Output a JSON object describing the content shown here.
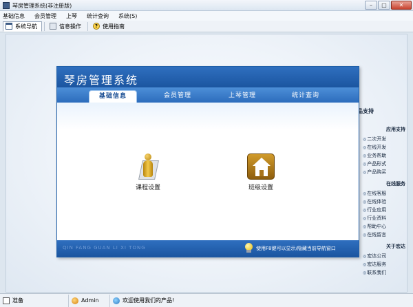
{
  "window": {
    "title": "琴房管理系统(非注册版)",
    "controls": {
      "minimize": "–",
      "maximize": "□",
      "close": "✕"
    }
  },
  "menu": [
    "基础信息",
    "会员管理",
    "上琴",
    "统计查询",
    "系统(S)"
  ],
  "toolbar": {
    "items": [
      {
        "label": "系统导航",
        "icon": "nav-window-icon"
      },
      {
        "label": "信息操作",
        "icon": "info-window-icon"
      },
      {
        "label": "使用指南",
        "icon": "help-icon",
        "glyph": "?"
      }
    ]
  },
  "nav": {
    "title": "琴房管理系统",
    "tabs": [
      "基础信息",
      "会员管理",
      "上琴管理",
      "统计查询"
    ],
    "active_tab": "基础信息",
    "modules": [
      {
        "label": "课程设置",
        "icon": "person-icon"
      },
      {
        "label": "班级设置",
        "icon": "house-icon"
      }
    ],
    "footer_pinyin": "QIN FANG GUAN LI XI TONG",
    "footer_tip": "使用F8键可以显示/隐藏当前导航窗口"
  },
  "side_panel": {
    "title": "品支持",
    "sections": [
      {
        "title": "应用支持",
        "links": [
          "二次开发",
          "在线开发",
          "业务帮助",
          "产品形式",
          "产品购买"
        ]
      },
      {
        "title": "在线服务",
        "links": [
          "在线客服",
          "在线体验",
          "行业应用",
          "行业资料",
          "帮助中心",
          "在线留言"
        ]
      },
      {
        "title": "关于宏达",
        "links": [
          "宏达公司",
          "宏达服务",
          "联系我们"
        ]
      }
    ]
  },
  "status": {
    "ready": "准备",
    "user": "Admin",
    "welcome": "欢迎使用我们的产品!"
  },
  "colors": {
    "nav_blue": "#1b55a0",
    "tab_blue": "#2c6cbc",
    "accent_gold": "#d19b2b"
  }
}
